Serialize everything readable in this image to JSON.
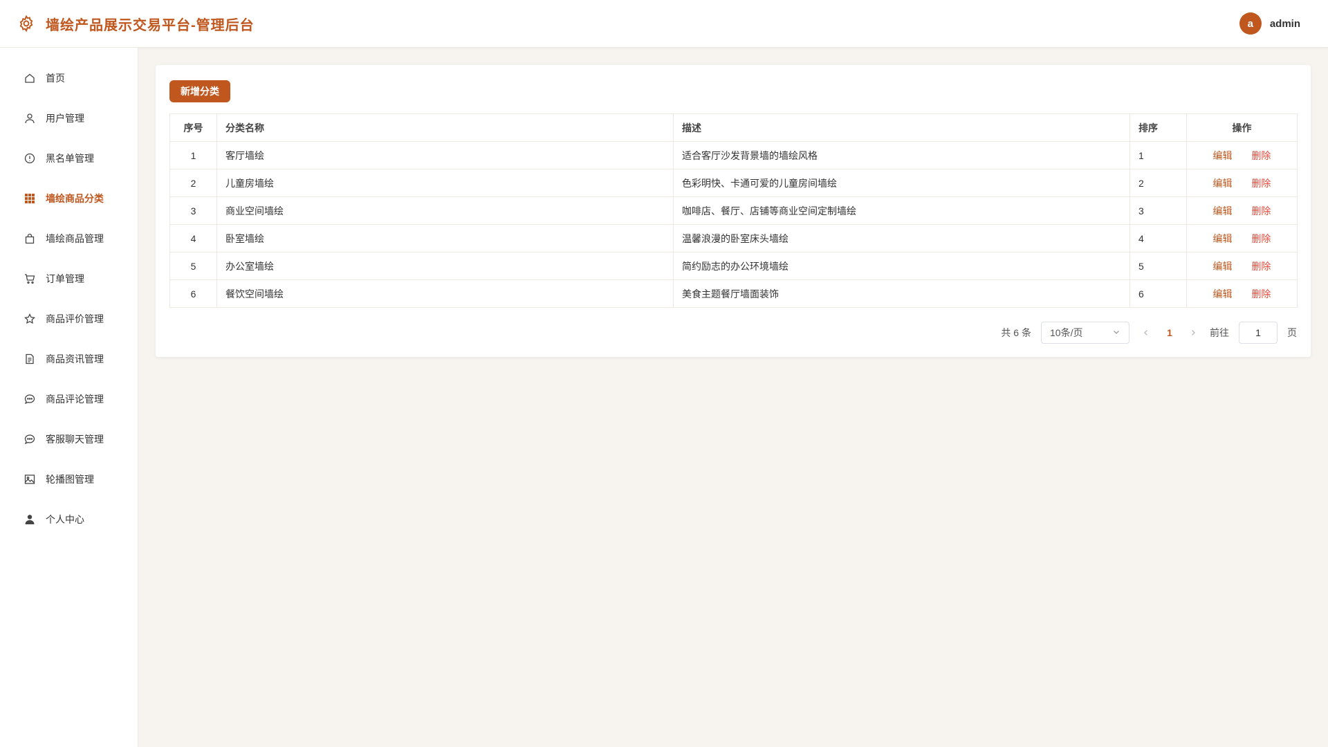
{
  "header": {
    "title": "墙绘产品展示交易平台-管理后台",
    "avatar_letter": "a",
    "username": "admin"
  },
  "sidebar": {
    "items": [
      {
        "label": "首页",
        "icon": "home-icon"
      },
      {
        "label": "用户管理",
        "icon": "user-icon"
      },
      {
        "label": "黑名单管理",
        "icon": "alert-circle-icon"
      },
      {
        "label": "墙绘商品分类",
        "icon": "grid-icon",
        "active": true
      },
      {
        "label": "墙绘商品管理",
        "icon": "bag-icon"
      },
      {
        "label": "订单管理",
        "icon": "cart-icon"
      },
      {
        "label": "商品评价管理",
        "icon": "star-icon"
      },
      {
        "label": "商品资讯管理",
        "icon": "document-icon"
      },
      {
        "label": "商品评论管理",
        "icon": "chat-icon"
      },
      {
        "label": "客服聊天管理",
        "icon": "chat-icon"
      },
      {
        "label": "轮播图管理",
        "icon": "image-icon"
      },
      {
        "label": "个人中心",
        "icon": "person-icon"
      }
    ]
  },
  "toolbar": {
    "add_label": "新增分类"
  },
  "table": {
    "headers": {
      "index": "序号",
      "name": "分类名称",
      "desc": "描述",
      "sort": "排序",
      "ops": "操作"
    },
    "edit_label": "编辑",
    "delete_label": "删除",
    "rows": [
      {
        "index": "1",
        "name": "客厅墙绘",
        "desc": "适合客厅沙发背景墙的墙绘风格",
        "sort": "1"
      },
      {
        "index": "2",
        "name": "儿童房墙绘",
        "desc": "色彩明快、卡通可爱的儿童房间墙绘",
        "sort": "2"
      },
      {
        "index": "3",
        "name": "商业空间墙绘",
        "desc": "咖啡店、餐厅、店铺等商业空间定制墙绘",
        "sort": "3"
      },
      {
        "index": "4",
        "name": "卧室墙绘",
        "desc": "温馨浪漫的卧室床头墙绘",
        "sort": "4"
      },
      {
        "index": "5",
        "name": "办公室墙绘",
        "desc": "简约励志的办公环境墙绘",
        "sort": "5"
      },
      {
        "index": "6",
        "name": "餐饮空间墙绘",
        "desc": "美食主题餐厅墙面装饰",
        "sort": "6"
      }
    ]
  },
  "pagination": {
    "total_text": "共 6 条",
    "page_size": "10条/页",
    "current_page": "1",
    "goto_label": "前往",
    "goto_value": "1",
    "page_unit": "页"
  },
  "colors": {
    "accent": "#c0571e",
    "danger": "#e04a3a"
  }
}
